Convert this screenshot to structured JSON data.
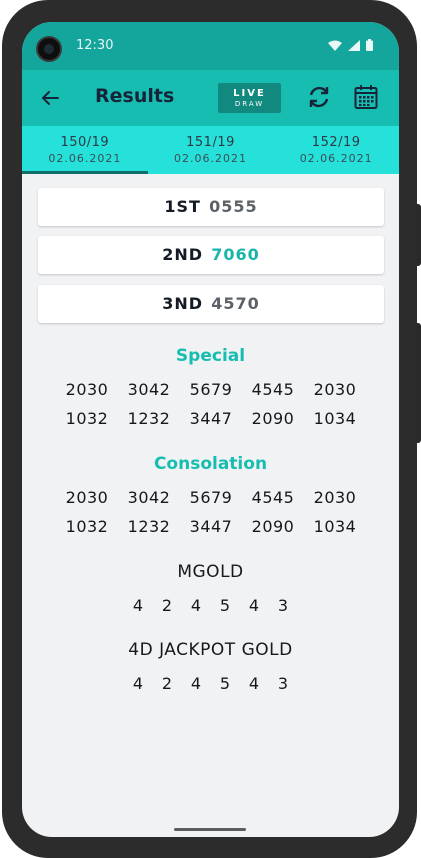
{
  "status_bar": {
    "time": "12:30",
    "icons": [
      "wifi-icon",
      "signal-icon",
      "battery-icon"
    ]
  },
  "app_bar": {
    "title": "Results",
    "live_line1": "LIVE",
    "live_line2": "DRAW",
    "icons": [
      "back-arrow-icon",
      "refresh-icon",
      "calendar-icon"
    ]
  },
  "tabs": [
    {
      "number": "150/19",
      "date": "02.06.2021",
      "active": true
    },
    {
      "number": "151/19",
      "date": "02.06.2021",
      "active": false
    },
    {
      "number": "152/19",
      "date": "02.06.2021",
      "active": false
    }
  ],
  "prizes": [
    {
      "label": "1ST",
      "value": "0555"
    },
    {
      "label": "2ND",
      "value": "7060"
    },
    {
      "label": "3ND",
      "value": "4570"
    }
  ],
  "special": {
    "title": "Special",
    "numbers": [
      "2030",
      "3042",
      "5679",
      "4545",
      "2030",
      "1032",
      "1232",
      "3447",
      "2090",
      "1034"
    ]
  },
  "consolation": {
    "title": "Consolation",
    "numbers": [
      "2030",
      "3042",
      "5679",
      "4545",
      "2030",
      "1032",
      "1232",
      "3447",
      "2090",
      "1034"
    ]
  },
  "mgold": {
    "title": "MGOLD",
    "digits": [
      "4",
      "2",
      "4",
      "5",
      "4",
      "3"
    ]
  },
  "jackpot": {
    "title": "4D JACKPOT GOLD",
    "digits": [
      "4",
      "2",
      "4",
      "5",
      "4",
      "3"
    ]
  },
  "colors": {
    "status_bar": "#14a59c",
    "app_bar": "#18bdb1",
    "tabs": "#26e1d9",
    "accent": "#18bdb1"
  }
}
